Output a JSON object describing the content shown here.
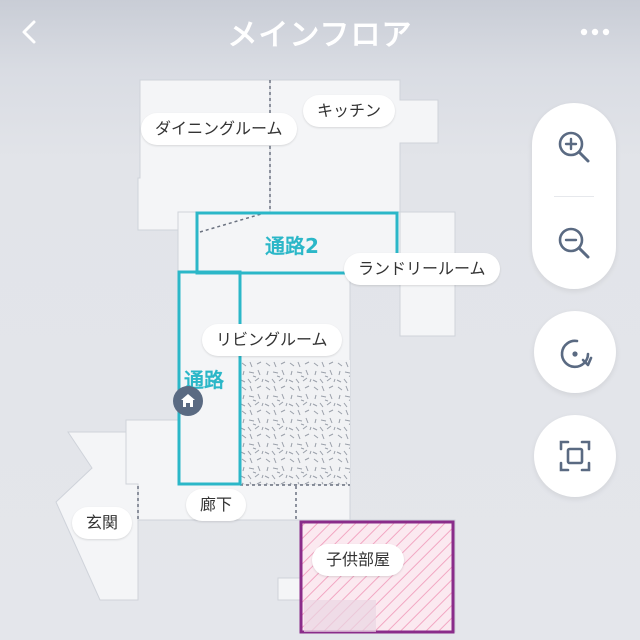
{
  "header": {
    "title": "メインフロア",
    "back_icon": "chevron-left-icon",
    "more_icon": "more-dots-icon"
  },
  "rooms": {
    "dining": "ダイニングルーム",
    "kitchen": "キッチン",
    "laundry": "ランドリールーム",
    "living": "リビングルーム",
    "hallway": "廊下",
    "entrance": "玄関",
    "kids_room": "子供部屋"
  },
  "zones": {
    "passage": "通路",
    "passage2": "通路2"
  },
  "controls": {
    "zoom_in_icon": "zoom-in-icon",
    "zoom_out_icon": "zoom-out-icon",
    "rotate_icon": "rotate-icon",
    "fit_icon": "fit-screen-icon"
  },
  "colors": {
    "zone_outline": "#2bb7c8",
    "kids_room_outline": "#8a2c8a",
    "kids_room_hatch": "#f2a7c3",
    "control_icon": "#5a6a82",
    "room_fill": "#f4f5f7"
  }
}
